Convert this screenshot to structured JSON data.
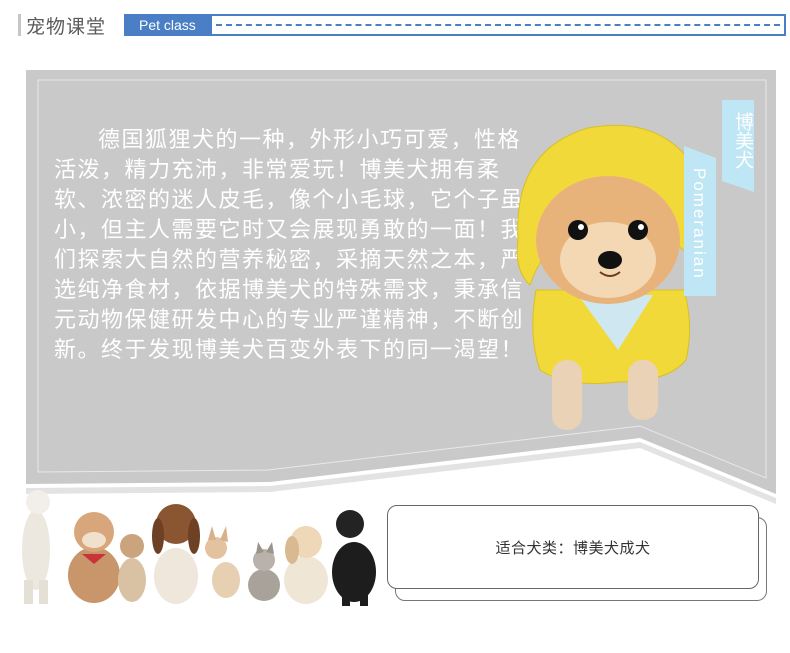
{
  "header": {
    "title": "宠物课堂",
    "tag": "Pet class"
  },
  "description": "德国狐狸犬的一种，外形小巧可爱，性格活泼，精力充沛，非常爱玩！博美犬拥有柔软、浓密的迷人皮毛，像个小毛球，它个子虽小，但主人需要它时又会展现勇敢的一面！我们探索大自然的营养秘密，采摘天然之本，严选纯净食材，依据博美犬的特殊需求，秉承信元动物保健研发中心的专业严谨精神，不断创新。终于发现博美犬百变外表下的同一渴望！",
  "ribbon": {
    "name_cn": "博美犬",
    "name_en": "Pomeranian"
  },
  "suitable": {
    "text": "适合犬类：博美犬成犬"
  },
  "colors": {
    "accent": "#4a7ec5",
    "panel": "#c9c9c9",
    "ribbon": "#bfe6f4",
    "raincoat": "#f2d93a"
  }
}
